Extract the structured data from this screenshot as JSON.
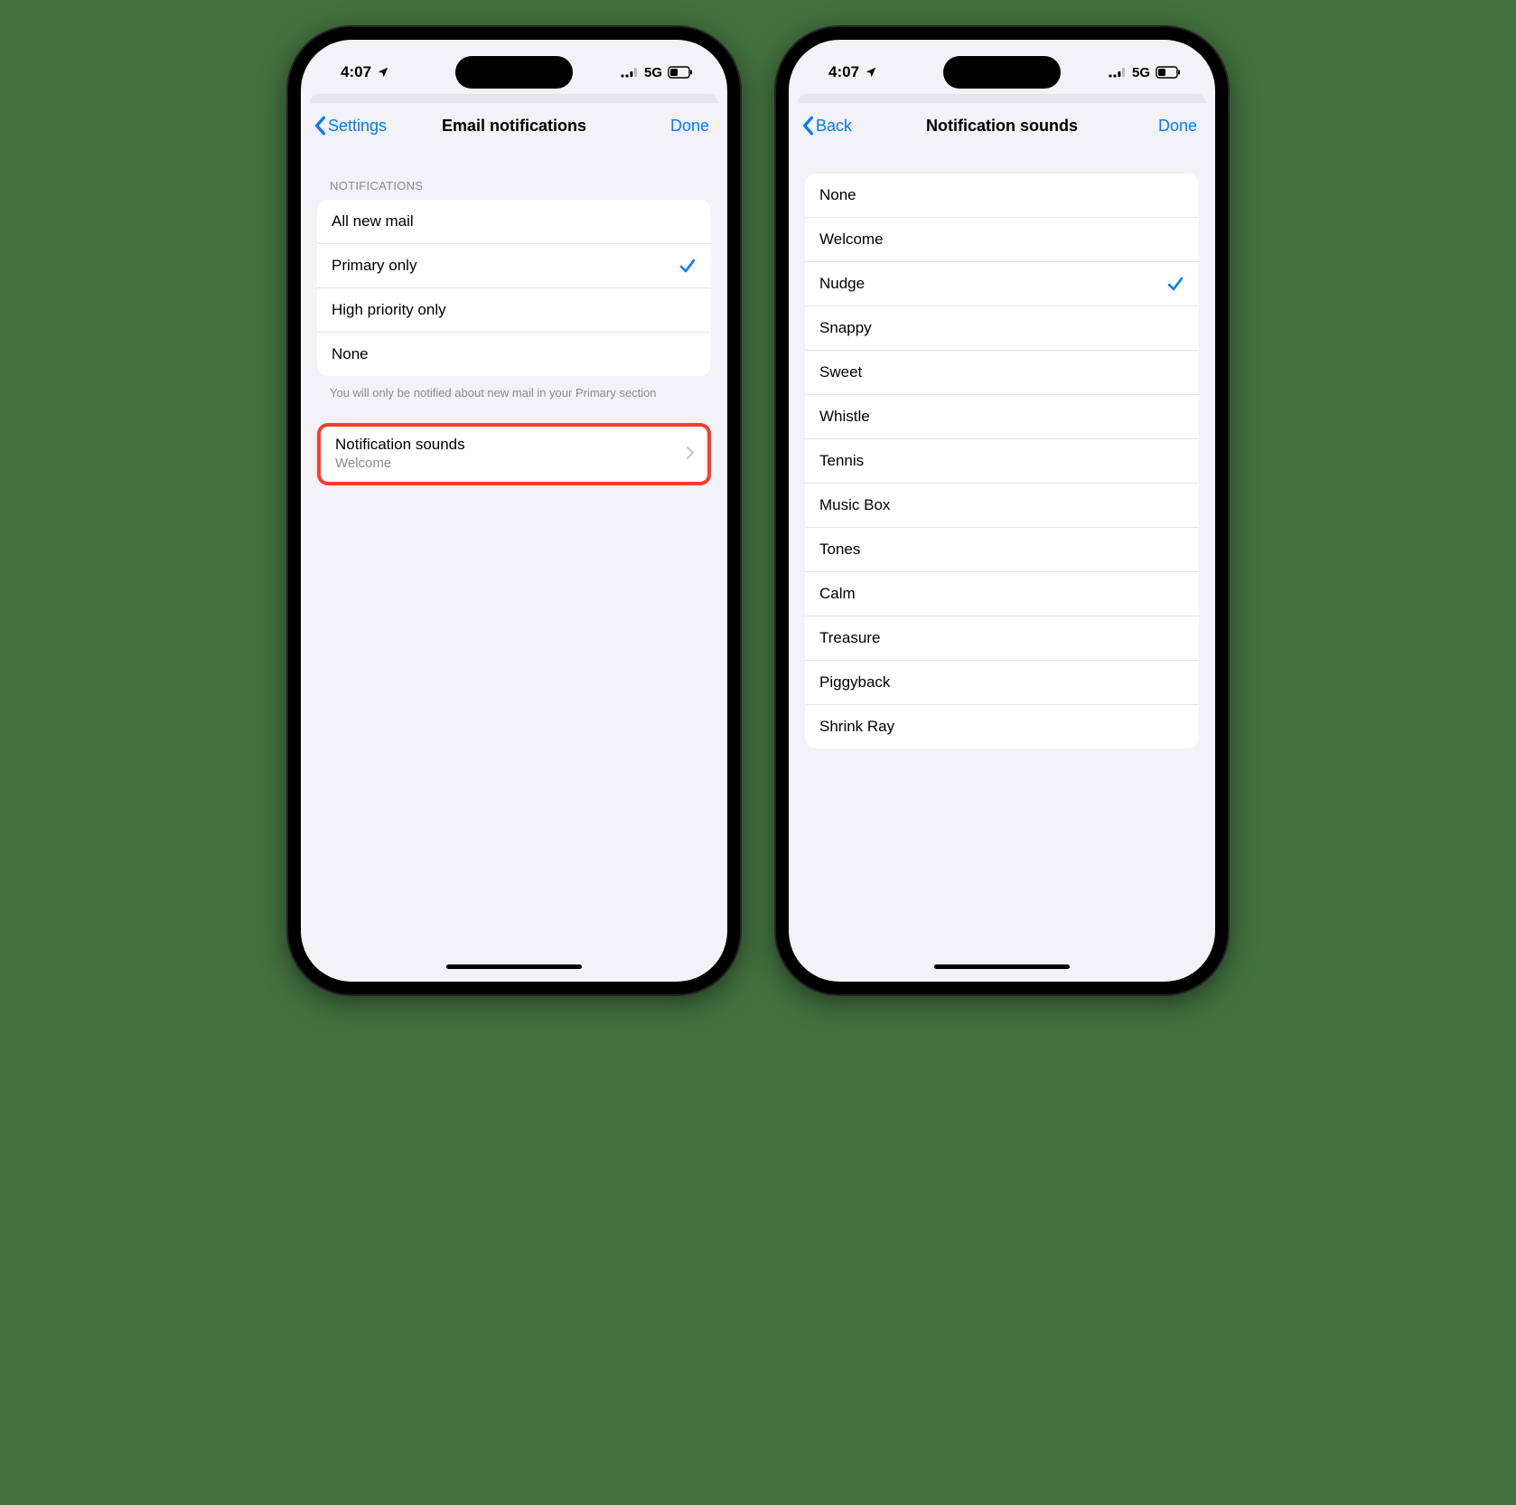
{
  "status": {
    "time": "4:07",
    "network": "5G"
  },
  "left": {
    "back_label": "Settings",
    "title": "Email notifications",
    "done_label": "Done",
    "section_header": "NOTIFICATIONS",
    "options": [
      {
        "label": "All new mail",
        "selected": false
      },
      {
        "label": "Primary only",
        "selected": true
      },
      {
        "label": "High priority only",
        "selected": false
      },
      {
        "label": "None",
        "selected": false
      }
    ],
    "footer": "You will only be notified about new mail in your Primary section",
    "sounds_row": {
      "title": "Notification sounds",
      "value": "Welcome",
      "highlighted": true
    }
  },
  "right": {
    "back_label": "Back",
    "title": "Notification sounds",
    "done_label": "Done",
    "sounds": [
      {
        "label": "None",
        "selected": false
      },
      {
        "label": "Welcome",
        "selected": false
      },
      {
        "label": "Nudge",
        "selected": true
      },
      {
        "label": "Snappy",
        "selected": false
      },
      {
        "label": "Sweet",
        "selected": false
      },
      {
        "label": "Whistle",
        "selected": false
      },
      {
        "label": "Tennis",
        "selected": false
      },
      {
        "label": "Music Box",
        "selected": false
      },
      {
        "label": "Tones",
        "selected": false
      },
      {
        "label": "Calm",
        "selected": false
      },
      {
        "label": "Treasure",
        "selected": false
      },
      {
        "label": "Piggyback",
        "selected": false
      },
      {
        "label": "Shrink Ray",
        "selected": false
      }
    ]
  }
}
